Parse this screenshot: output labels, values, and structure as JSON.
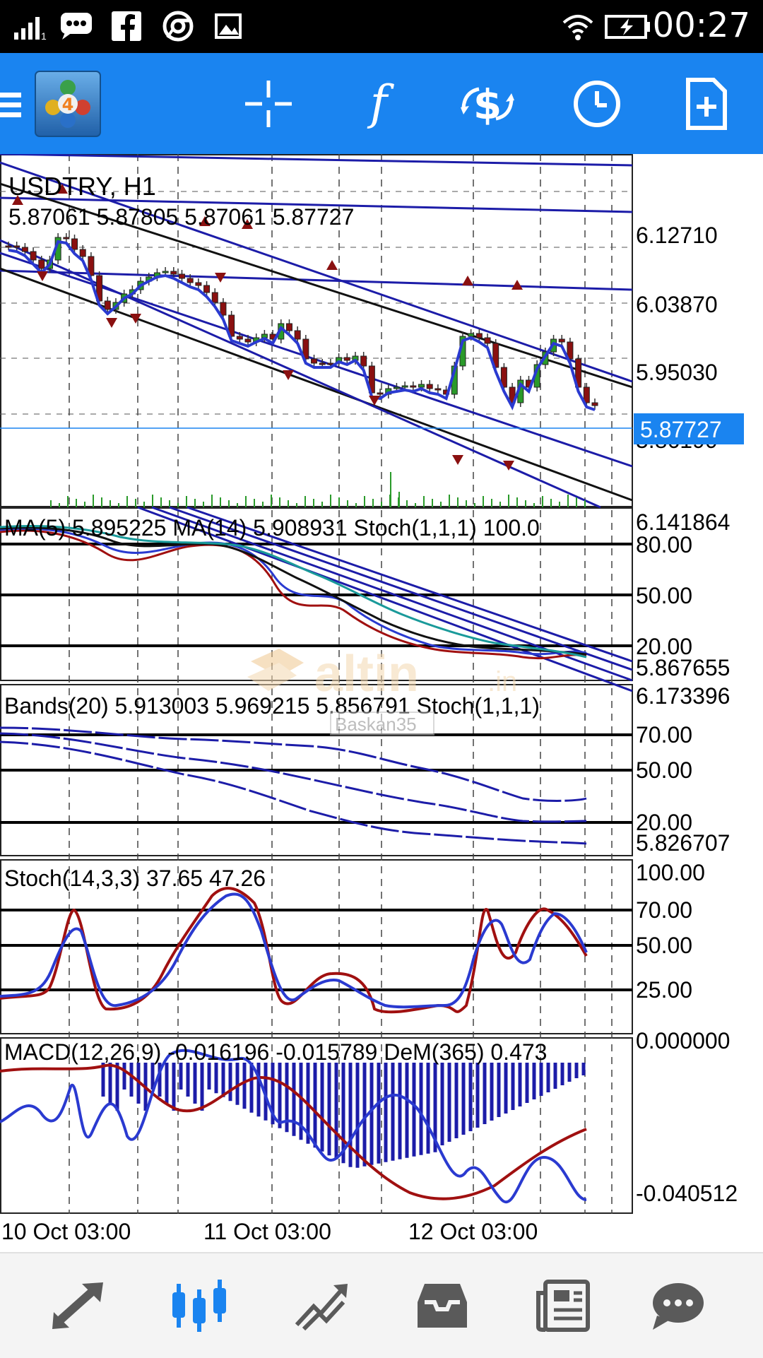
{
  "status_bar": {
    "time": "00:27",
    "icons": [
      "signal-icon",
      "chat-icon",
      "facebook-icon",
      "chrome-icon",
      "gallery-icon",
      "wifi-icon",
      "battery-charging-icon"
    ]
  },
  "toolbar": {
    "icons": [
      "menu-icon",
      "app-logo-icon",
      "crosshair-icon",
      "function-icon",
      "symbol-change-icon",
      "timeframe-clock-icon",
      "new-order-icon"
    ],
    "accent": "#1a84f0"
  },
  "chart": {
    "symbol_title": "USDTRY, H1",
    "ohlc": "5.87061 5.87805 5.87061 5.87727",
    "current_price": "5.87727",
    "price_ticks": [
      "6.12710",
      "6.03870",
      "5.95030",
      "5.86190"
    ],
    "panes": {
      "ma_stoch": {
        "label": "MA(5) 5.895225 MA(14) 5.908931 Stoch(1,1,1) 100.0",
        "max": "6.141864",
        "min": "5.867655",
        "levels": [
          "80.00",
          "50.00",
          "20.00"
        ]
      },
      "bands": {
        "label": "Bands(20) 5.913003 5.969215 5.856791 Stoch(1,1,1)",
        "max": "6.173396",
        "min": "5.826707",
        "levels": [
          "70.00",
          "50.00",
          "20.00"
        ]
      },
      "stoch": {
        "label": "Stoch(14,3,3) 37.65 47.26",
        "levels": [
          "100.00",
          "70.00",
          "50.00",
          "25.00"
        ]
      },
      "macd": {
        "label": "MACD(12,26,9) -0.016196 -0.015789 DeM(365) 0.473",
        "max": "0.000000",
        "min": "-0.040512"
      }
    },
    "time_labels": [
      "10 Oct 03:00",
      "11 Oct 03:00",
      "12 Oct 03:00"
    ],
    "watermark": {
      "brand": "altin",
      "suffix": ".in",
      "user": "Baskan35"
    },
    "colors": {
      "bull": "#2a9a2a",
      "bear": "#8a1010",
      "indicator_blue": "#1c1ca8",
      "signal_red": "#a01010",
      "price_tag": "#1a84f0",
      "teal": "#1a9a9a"
    }
  },
  "bottom_nav": {
    "items": [
      "quotes-icon",
      "chart-icon",
      "trade-icon",
      "history-icon",
      "news-icon",
      "messages-icon"
    ],
    "active_index": 1
  }
}
